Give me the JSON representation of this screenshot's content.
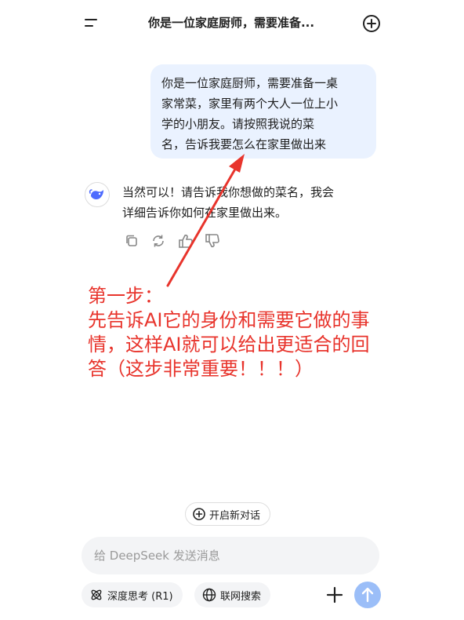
{
  "header": {
    "title": "你是一位家庭厨师，需要准备...",
    "menu_icon": "menu-icon",
    "new_chat_icon": "new-chat-icon"
  },
  "user_message": {
    "lines": [
      "你是一位家庭厨师，需要准备一桌",
      "家常菜，家里有两个大人一位上小",
      "学的小朋友。请按照我说的菜",
      "名，告诉我要怎么在家里做出来"
    ]
  },
  "ai_message": {
    "avatar_icon": "deepseek-whale-icon",
    "lines": [
      "当然可以！请告诉我你想做的菜名，我会",
      "详细告诉你如何在家里做出来。"
    ],
    "actions": [
      "copy-icon",
      "regenerate-icon",
      "thumbs-up-icon",
      "thumbs-down-icon"
    ]
  },
  "annotation": {
    "lines": [
      "第一步：",
      "先告诉AI它的身份和需要它做的事",
      "情，这样AI就可以给出更适合的回",
      "答（这步非常重要！！！）"
    ],
    "color": "#e8342c"
  },
  "new_conversation": {
    "label": "开启新对话",
    "icon": "plus-circle-icon"
  },
  "composer": {
    "placeholder": "给 DeepSeek 发送消息",
    "value": ""
  },
  "toolbar": {
    "deep_think_label": "深度思考 (R1)",
    "web_search_label": "联网搜索",
    "attach_icon": "plus-icon",
    "send_icon": "send-arrow-icon"
  },
  "colors": {
    "accent": "#4d6bfe",
    "user_bubble_bg": "#eaf2ff",
    "send_button": "#9bbef8",
    "annotation_red": "#e8342c"
  }
}
